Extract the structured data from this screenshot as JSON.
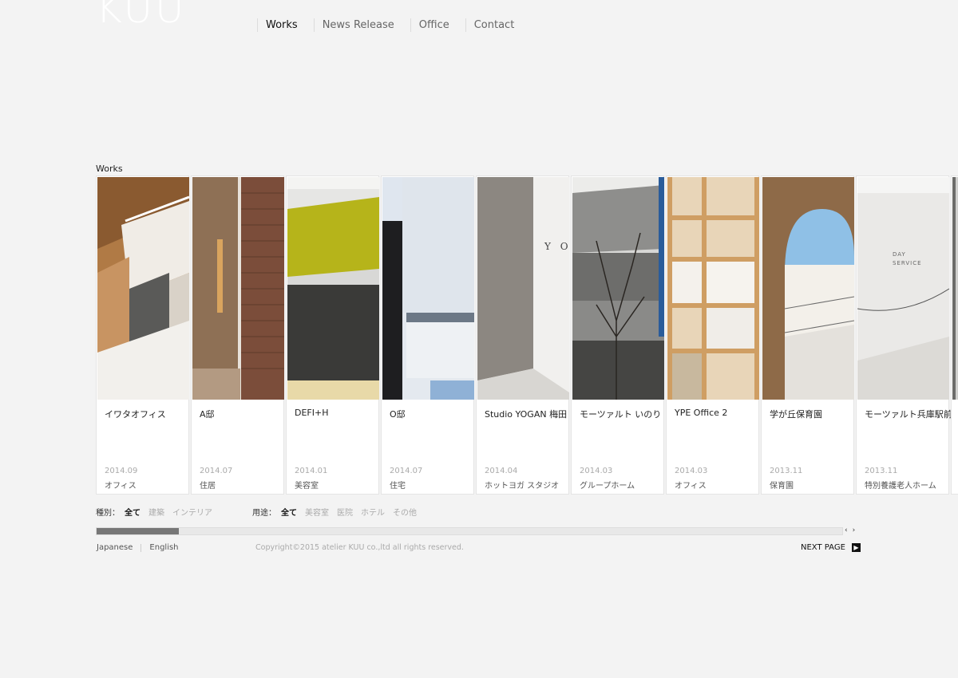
{
  "logo": "KUU",
  "nav": [
    {
      "label": "Works",
      "active": true
    },
    {
      "label": "News Release",
      "active": false
    },
    {
      "label": "Office",
      "active": false
    },
    {
      "label": "Contact",
      "active": false
    }
  ],
  "section_label": "Works",
  "works": [
    {
      "title": "イワタオフィス",
      "date": "2014.09",
      "category": "オフィス"
    },
    {
      "title": "A邸",
      "date": "2014.07",
      "category": "住居"
    },
    {
      "title": "DEFI+H",
      "date": "2014.01",
      "category": "美容室"
    },
    {
      "title": "O邸",
      "date": "2014.07",
      "category": "住宅"
    },
    {
      "title": "Studio YOGAN 梅田",
      "date": "2014.04",
      "category": "ホットヨガ スタジオ"
    },
    {
      "title": "モーツァルト いのり",
      "date": "2014.03",
      "category": "グループホーム"
    },
    {
      "title": "YPE Office 2",
      "date": "2014.03",
      "category": "オフィス"
    },
    {
      "title": "学が丘保育園",
      "date": "2013.11",
      "category": "保育園"
    },
    {
      "title": "モーツァルト兵庫駅前",
      "date": "2013.11",
      "category": "特別養護老人ホーム"
    }
  ],
  "photo_text": {
    "yogan_sign": "Y O",
    "day_service": "DAY\nSERVICE"
  },
  "filters": {
    "type_label": "種別：",
    "type_items": [
      {
        "label": "全て",
        "on": true
      },
      {
        "label": "建築",
        "on": false
      },
      {
        "label": "インテリア",
        "on": false
      }
    ],
    "use_label": "用途：",
    "use_items": [
      {
        "label": "全て",
        "on": true
      },
      {
        "label": "美容室",
        "on": false
      },
      {
        "label": "医院",
        "on": false
      },
      {
        "label": "ホテル",
        "on": false
      },
      {
        "label": "その他",
        "on": false
      }
    ]
  },
  "scroll_position": 0.11,
  "scroll_arrows": {
    "left": "‹",
    "right": "›"
  },
  "footer": {
    "lang_japanese": "Japanese",
    "lang_english": "English",
    "copyright": "Copyright©2015 atelier KUU co.,ltd all rights reserved.",
    "next_page": "NEXT PAGE",
    "next_arrow": "▶"
  }
}
